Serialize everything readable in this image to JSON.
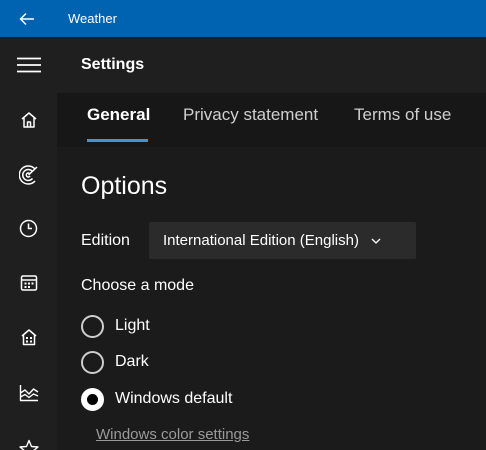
{
  "titlebar": {
    "title": "Weather"
  },
  "header": {
    "title": "Settings"
  },
  "tabs": [
    {
      "label": "General",
      "active": true
    },
    {
      "label": "Privacy statement",
      "active": false
    },
    {
      "label": "Terms of use",
      "active": false
    }
  ],
  "options": {
    "title": "Options",
    "edition_label": "Edition",
    "edition_value": "International Edition (English)",
    "mode_label": "Choose a mode",
    "modes": [
      {
        "label": "Light",
        "checked": false
      },
      {
        "label": "Dark",
        "checked": false
      },
      {
        "label": "Windows default",
        "checked": true
      }
    ],
    "color_link": "Windows color settings"
  },
  "rail": {
    "items": [
      "menu-icon",
      "home-icon",
      "forecast-icon",
      "historical-icon",
      "calendar-icon",
      "places-icon",
      "chart-icon",
      "favorite-icon"
    ]
  },
  "colors": {
    "accent": "#0063b1",
    "underline": "#3a96dd",
    "background": "#1b1b1b"
  }
}
